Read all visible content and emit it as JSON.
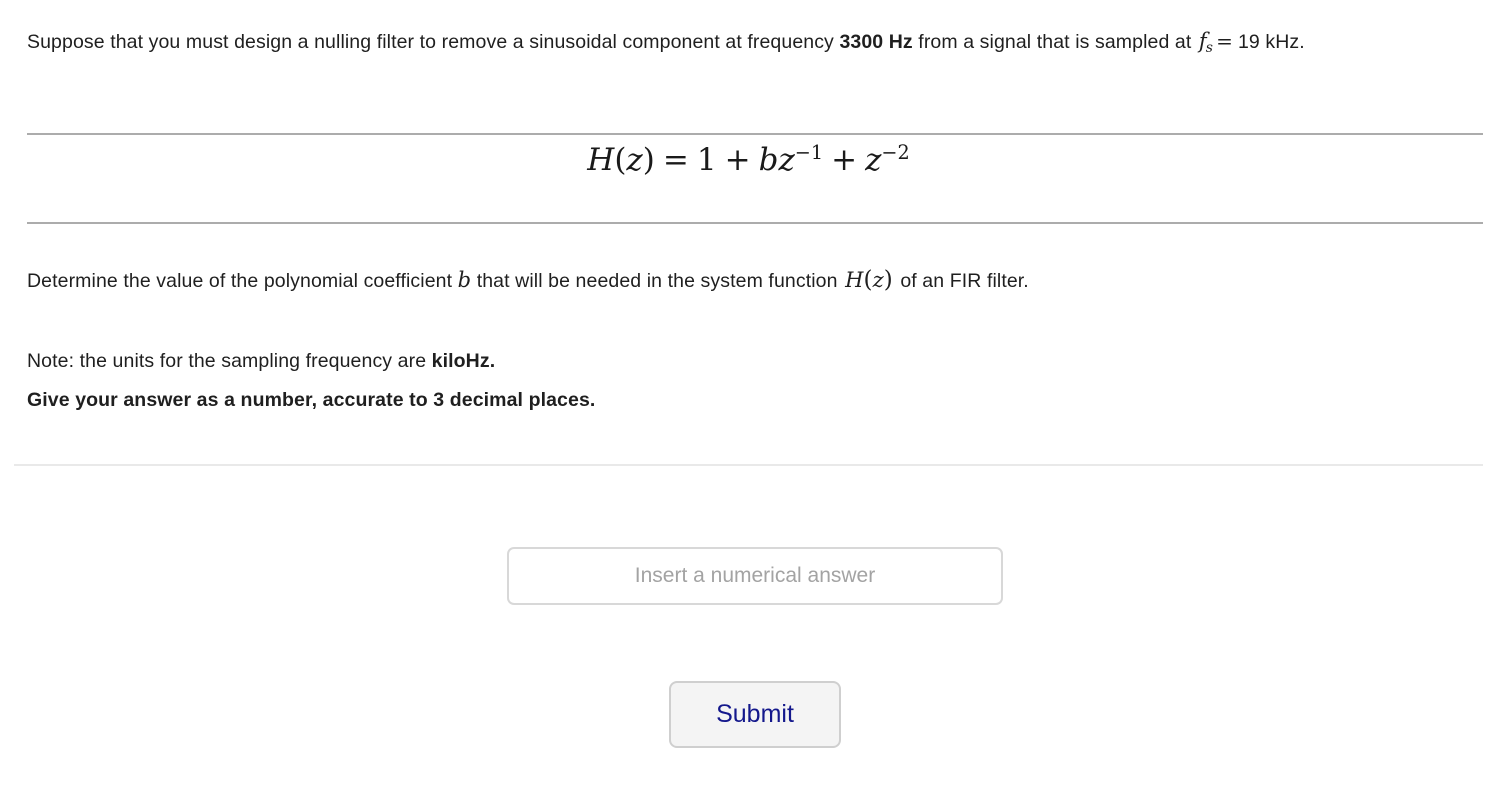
{
  "problem": {
    "intro": {
      "part1": "Suppose that you must design a nulling filter to remove a sinusoidal component at frequency ",
      "frequency_bold": "3300 Hz",
      "part2": " from a signal that is sampled at ",
      "fs_symbol": "f",
      "fs_subscript": "s",
      "equals": "=",
      "sampling_rate": "19 kHz."
    },
    "equation": {
      "lhs_function": "H",
      "lhs_arg": "z",
      "equals": "=",
      "term_one": "1",
      "plus_1": "+",
      "coefficient": "b",
      "var_z_1": "z",
      "exponent_1": "−1",
      "plus_2": "+",
      "var_z_2": "z",
      "exponent_2": "−2",
      "plain_text": "H(z) = 1 + bz^-1 + z^-2"
    },
    "determine": {
      "part1": "Determine the value of the polynomial coefficient ",
      "coefficient_symbol": "b",
      "part2": " that will be needed in the system function ",
      "function_symbol": "H",
      "function_arg": "z",
      "part3": " of an FIR filter."
    },
    "note": {
      "line1_part1": "Note: the units for the sampling frequency are ",
      "line1_bold": "kiloHz.",
      "line2": "Give your answer as a number, accurate to 3 decimal places."
    }
  },
  "answer": {
    "placeholder": "Insert a numerical answer",
    "value": "",
    "submit_label": "Submit"
  },
  "colors": {
    "text": "#1f1f1f",
    "rule_strong": "#acacac",
    "rule_light": "#e9e9e9",
    "placeholder": "#a3a3a3",
    "submit_text": "#14188c",
    "submit_background": "#f4f4f4",
    "page_background": "#ffffff"
  }
}
